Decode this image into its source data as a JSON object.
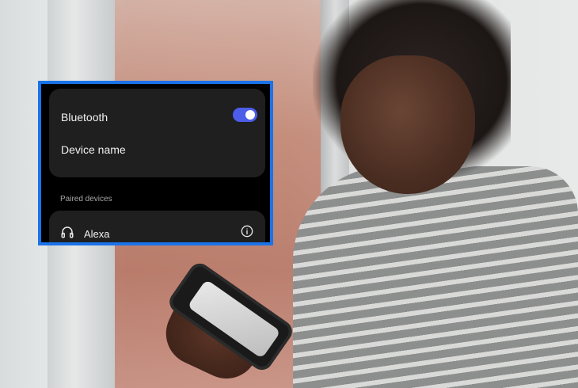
{
  "bluetooth_screen": {
    "bluetooth_label": "Bluetooth",
    "bluetooth_enabled": true,
    "device_name_label": "Device name",
    "paired_section_label": "Paired devices",
    "paired_devices": [
      {
        "name": "Alexa",
        "icon": "headphones-icon",
        "info_icon": "info-icon"
      }
    ]
  },
  "colors": {
    "accent_border": "#1a73e8",
    "toggle_on": "#4b5de9",
    "panel_bg": "#000000",
    "card_bg": "#1f1f1f"
  }
}
